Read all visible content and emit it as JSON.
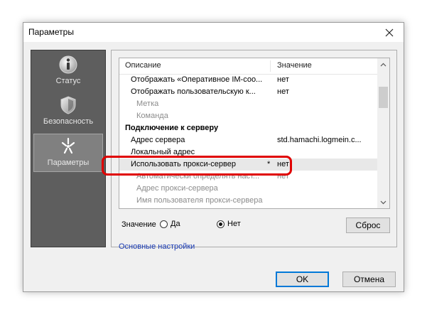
{
  "window": {
    "title": "Параметры"
  },
  "sidebar": {
    "items": [
      {
        "label": "Статус",
        "icon": "info-icon",
        "active": false
      },
      {
        "label": "Безопасность",
        "icon": "shield-icon",
        "active": false
      },
      {
        "label": "Параметры",
        "icon": "settings-sparkle-icon",
        "active": true
      }
    ]
  },
  "list": {
    "columns": {
      "description": "Описание",
      "value": "Значение"
    },
    "rows": [
      {
        "name": "Отображать «Оперативное IM-соо...",
        "value": "нет",
        "kind": "item"
      },
      {
        "name": "Отображать пользовательскую к...",
        "value": "нет",
        "kind": "item"
      },
      {
        "name": "Метка",
        "value": "",
        "kind": "sub"
      },
      {
        "name": "Команда",
        "value": "",
        "kind": "sub"
      },
      {
        "name": "Подключение к серверу",
        "value": "",
        "kind": "group"
      },
      {
        "name": "Адрес сервера",
        "value": "std.hamachi.logmein.c...",
        "kind": "item"
      },
      {
        "name": "Локальный адрес",
        "value": "",
        "kind": "item"
      },
      {
        "name": "Использовать прокси-сервер",
        "value": "нет",
        "kind": "selected",
        "star": "*"
      },
      {
        "name": "Автоматически определять наст...",
        "value": "нет",
        "kind": "sub"
      },
      {
        "name": "Адрес прокси-сервера",
        "value": "",
        "kind": "sub"
      },
      {
        "name": "Имя пользователя прокси-сервера",
        "value": "",
        "kind": "sub"
      }
    ]
  },
  "value_editor": {
    "label": "Значение",
    "option_yes": "Да",
    "option_no": "Нет",
    "selected": "no",
    "reset_label": "Сброс"
  },
  "basic_settings_link": "Основные настройки",
  "buttons": {
    "ok": "OK",
    "cancel": "Отмена"
  },
  "colors": {
    "highlight": "#e00000",
    "sidebar_bg": "#5e5e5e",
    "link": "#1a3bb3"
  }
}
